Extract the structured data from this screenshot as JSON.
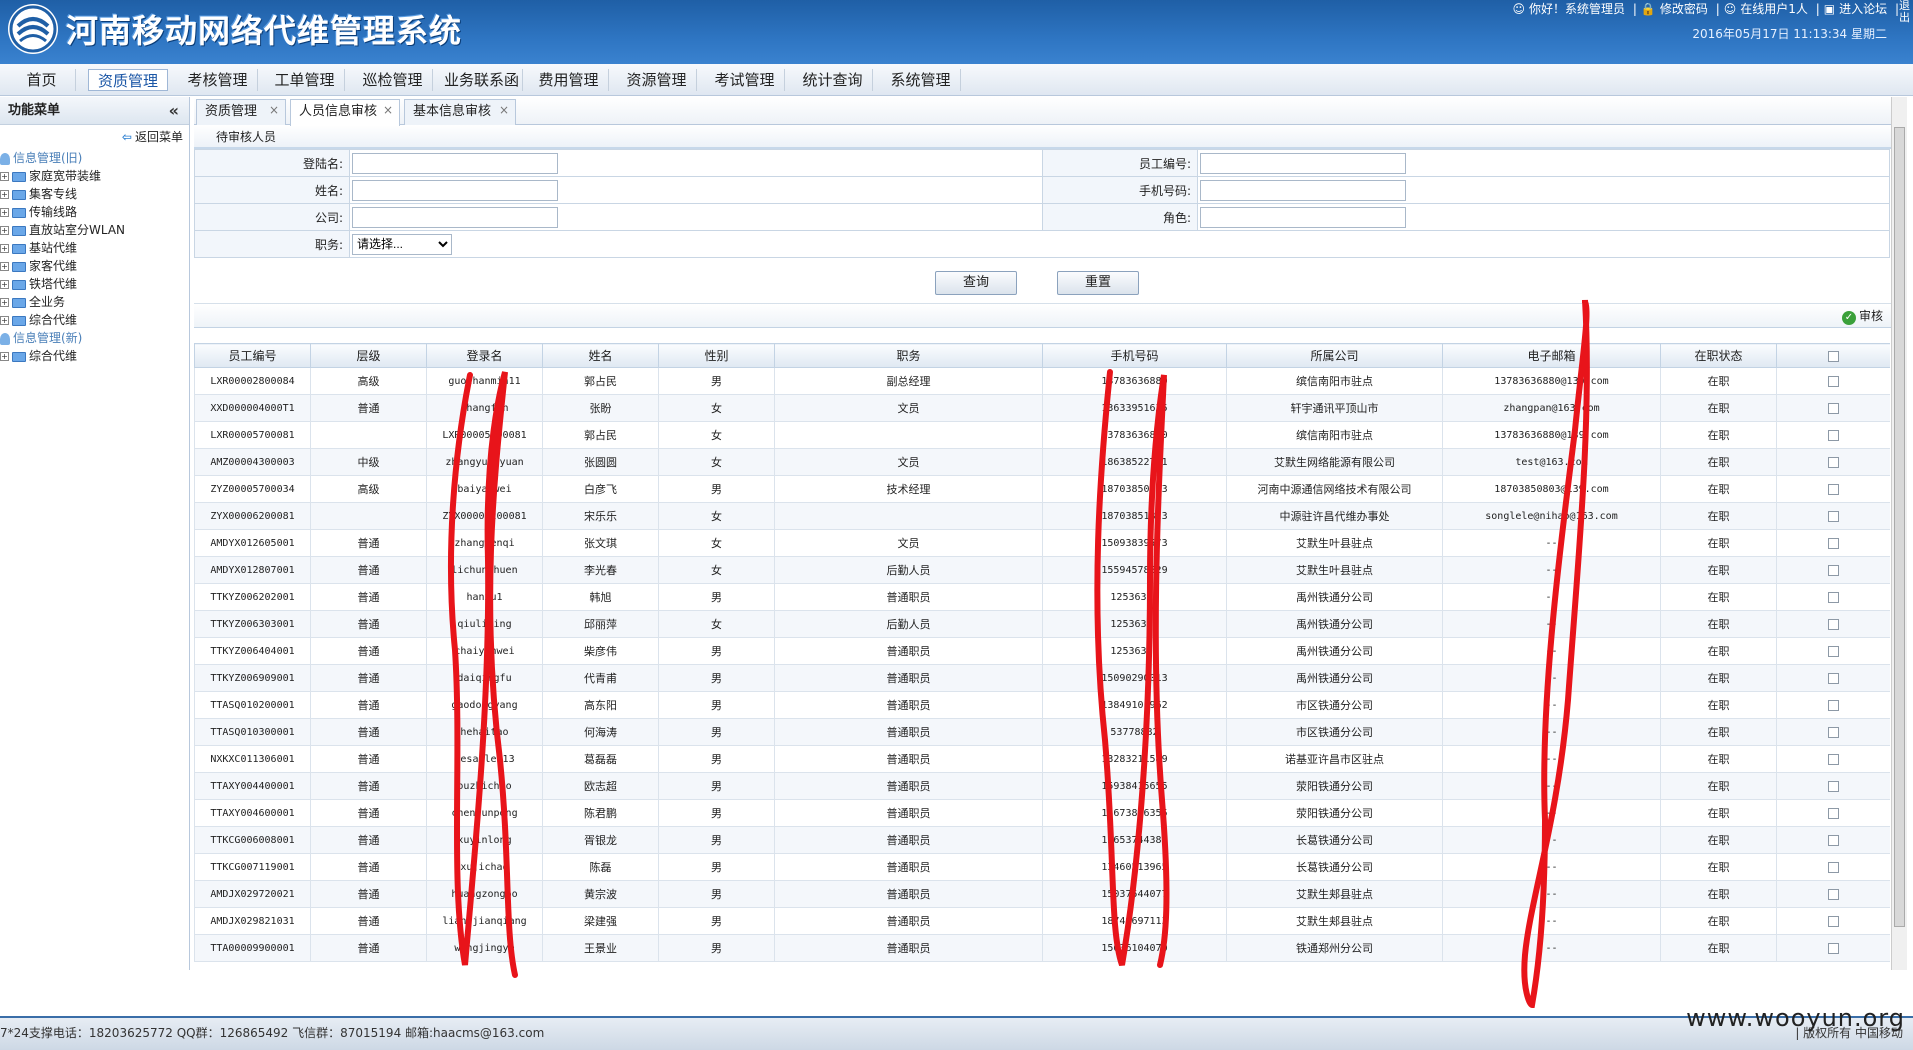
{
  "header": {
    "title": "河南移动网络代维管理系统",
    "links": [
      "你好！系统管理员",
      "修改密码",
      "在线用户1人",
      "进入论坛"
    ],
    "exit": "退出",
    "datetime": "2016年05月17日  11:13:34 星期二"
  },
  "nav": {
    "items": [
      "首页",
      "资质管理",
      "考核管理",
      "工单管理",
      "巡检管理",
      "业务联系函",
      "费用管理",
      "资源管理",
      "考试管理",
      "统计查询",
      "系统管理"
    ],
    "active": "资质管理"
  },
  "sidebar": {
    "title": "功能菜单",
    "collapse": "«",
    "back": "返回菜单",
    "tree": [
      {
        "label": "信息管理(旧)",
        "root": true
      },
      {
        "label": "家庭宽带装维"
      },
      {
        "label": "集客专线"
      },
      {
        "label": "传输线路"
      },
      {
        "label": "直放站室分WLAN"
      },
      {
        "label": "基站代维"
      },
      {
        "label": "家客代维"
      },
      {
        "label": "铁塔代维"
      },
      {
        "label": "全业务"
      },
      {
        "label": "综合代维"
      },
      {
        "label": "信息管理(新)",
        "root": true
      },
      {
        "label": "综合代维"
      }
    ]
  },
  "tabs": [
    "资质管理",
    "人员信息审核",
    "基本信息审核"
  ],
  "panel_title": "待审核人员",
  "filter": {
    "login_label": "登陆名:",
    "name_label": "姓名:",
    "company_label": "公司:",
    "duty_label": "职务:",
    "duty_value": "请选择...",
    "empno_label": "员工编号:",
    "phone_label": "手机号码:",
    "role_label": "角色:"
  },
  "buttons": {
    "query": "查询",
    "reset": "重置",
    "audit": "审核",
    "audit_icon": "check-circle-icon"
  },
  "grid": {
    "columns": [
      "员工编号",
      "层级",
      "登录名",
      "姓名",
      "性别",
      "职务",
      "手机号码",
      "所属公司",
      "电子邮箱",
      "在职状态"
    ],
    "rows": [
      [
        "LXR00002800084",
        "高级",
        "guozhanmin11",
        "郭占民",
        "男",
        "副总经理",
        "13783636880",
        "缤信南阳市驻点",
        "13783636880@139.com",
        "在职"
      ],
      [
        "XXD000004000T1",
        "普通",
        "zhangfan",
        "张盼",
        "女",
        "文员",
        "13633951635",
        "轩宇通讯平顶山市",
        "zhangpan@163.com",
        "在职"
      ],
      [
        "LXR00005700081",
        "",
        "LXR00005700081",
        "郭占民",
        "女",
        "",
        "13783636880",
        "缤信南阳市驻点",
        "13783636880@139.com",
        "在职"
      ],
      [
        "AMZ00004300003",
        "中级",
        "zhangyuanyuan",
        "张圆圆",
        "女",
        "文员",
        "18638522751",
        "艾默生网络能源有限公司",
        "test@163.com",
        "在职"
      ],
      [
        "ZYZ00005700034",
        "高级",
        "baiyanwei",
        "白彦飞",
        "男",
        "技术经理",
        "18703850803",
        "河南中源通信网络技术有限公司",
        "18703850803@139.com",
        "在职"
      ],
      [
        "ZYX00006200081",
        "",
        "ZYX00006200081",
        "宋乐乐",
        "女",
        "",
        "18703851823",
        "中源驻许昌代维办事处",
        "songlele@nihao@163.com",
        "在职"
      ],
      [
        "AMDYX012605001",
        "普通",
        "zhangwenqi",
        "张文琪",
        "女",
        "文员",
        "15093839573",
        "艾默生叶县驻点",
        "--",
        "在职"
      ],
      [
        "AMDYX012807001",
        "普通",
        "lichunchuen",
        "李光春",
        "女",
        "后勤人员",
        "15594578829",
        "艾默生叶县驻点",
        "--",
        "在职"
      ],
      [
        "TTKYZ006202001",
        "普通",
        "hanxu1",
        "韩旭",
        "男",
        "普通职员",
        "12536311",
        "禹州铁通分公司",
        "--",
        "在职"
      ],
      [
        "TTKYZ006303001",
        "普通",
        "qiuliping",
        "邱丽萍",
        "女",
        "后勤人员",
        "12536312",
        "禹州铁通分公司",
        "--",
        "在职"
      ],
      [
        "TTKYZ006404001",
        "普通",
        "chaiyanwei",
        "柴彦伟",
        "男",
        "普通职员",
        "12536318",
        "禹州铁通分公司",
        "--",
        "在职"
      ],
      [
        "TTKYZ006909001",
        "普通",
        "daiqingfu",
        "代青甫",
        "男",
        "普通职员",
        "15090290013",
        "禹州铁通分公司",
        "--",
        "在职"
      ],
      [
        "TTASQ010200001",
        "普通",
        "gaodongyang",
        "高东阳",
        "男",
        "普通职员",
        "13849101962",
        "市区铁通分公司",
        "--",
        "在职"
      ],
      [
        "TTASQ010300001",
        "普通",
        "hehaitao",
        "何海涛",
        "男",
        "普通职员",
        "53778882",
        "市区铁通分公司",
        "--",
        "在职"
      ],
      [
        "NXKXC011306001",
        "普通",
        "gesanlei13",
        "葛磊磊",
        "男",
        "普通职员",
        "13283211589",
        "诺基亚许昌市区驻点",
        "--",
        "在职"
      ],
      [
        "TTAXY004400001",
        "普通",
        "ouzhichao",
        "欧志超",
        "男",
        "普通职员",
        "15938415655",
        "荥阳铁通分公司",
        "--",
        "在职"
      ],
      [
        "TTAXY004600001",
        "普通",
        "chenjunpeng",
        "陈君鹏",
        "男",
        "普通职员",
        "13673816355",
        "荥阳铁通分公司",
        "--",
        "在职"
      ],
      [
        "TTKCG006008001",
        "普通",
        "xuyinlong",
        "胥银龙",
        "男",
        "普通职员",
        "13653744380",
        "长葛铁通分公司",
        "--",
        "在职"
      ],
      [
        "TTKCG007119001",
        "普通",
        "xujichao",
        "陈磊",
        "男",
        "普通职员",
        "13460513965",
        "长葛铁通分公司",
        "--",
        "在职"
      ],
      [
        "AMDJX029720021",
        "普通",
        "huangzongbo",
        "黄宗波",
        "男",
        "普通职员",
        "15037544077",
        "艾默生郏县驻点",
        "--",
        "在职"
      ],
      [
        "AMDJX029821031",
        "普通",
        "liangjianqiang",
        "梁建强",
        "男",
        "普通职员",
        "18749697113",
        "艾默生郏县驻点",
        "--",
        "在职"
      ],
      [
        "TTA00009900001",
        "普通",
        "wangjingye",
        "王景业",
        "男",
        "普通职员",
        "15036104070",
        "铁通郑州分公司",
        "--",
        "在职"
      ]
    ]
  },
  "footer": {
    "contact": "7*24支撑电话：18203625772 QQ群：126865492 飞信群：87015194 邮箱:haacms@163.com",
    "copyright": "| 版权所有 中国移动"
  },
  "watermark": "www.wooyun.org",
  "colors": {
    "header": "#2e75c2",
    "accent": "#1a56a6",
    "scribble": "#e8141a"
  }
}
